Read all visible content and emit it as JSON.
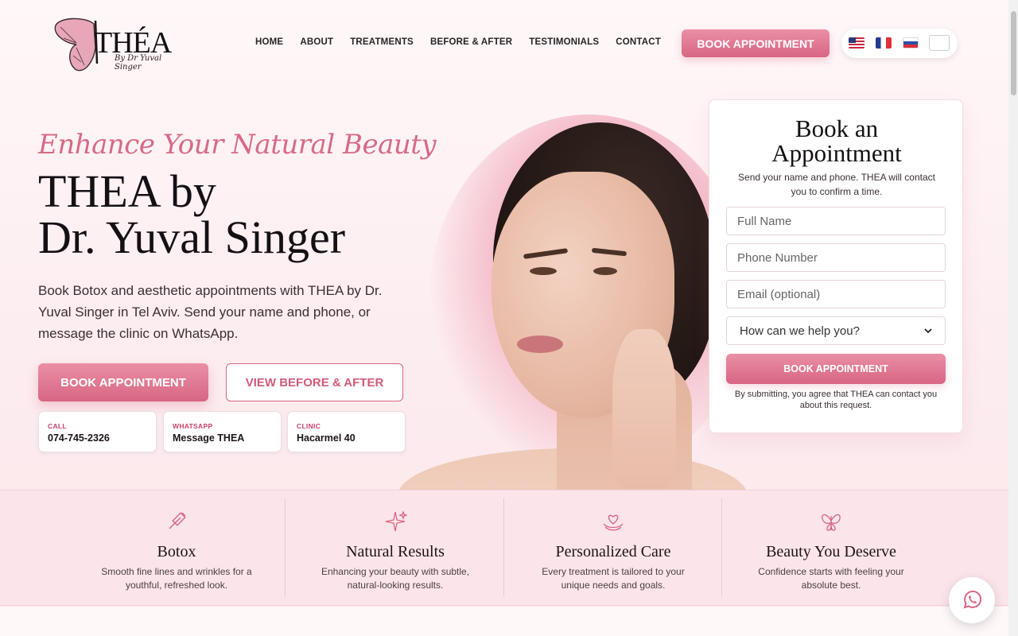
{
  "brand": {
    "logo_text": "THÉA",
    "logo_signature": "By Dr Yuval Singer"
  },
  "nav": {
    "items": [
      "HOME",
      "ABOUT",
      "TREATMENTS",
      "BEFORE & AFTER",
      "TESTIMONIALS",
      "CONTACT"
    ]
  },
  "header": {
    "book_label": "BOOK APPOINTMENT"
  },
  "languages": [
    "us-flag",
    "fr-flag",
    "ru-flag"
  ],
  "hero": {
    "eyebrow": "Enhance Your Natural Beauty",
    "title_line1": "THEA by",
    "title_line2": "Dr. Yuval Singer",
    "description": "Book Botox and aesthetic appointments with THEA by Dr. Yuval Singer in Tel Aviv. Send your name and phone, or message the clinic on WhatsApp.",
    "primary_label": "BOOK APPOINTMENT",
    "secondary_label": "VIEW BEFORE & AFTER",
    "cards": [
      {
        "label": "CALL",
        "value": "074-745-2326"
      },
      {
        "label": "WHATSAPP",
        "value": "Message THEA"
      },
      {
        "label": "CLINIC",
        "value": "Hacarmel 40"
      }
    ]
  },
  "form": {
    "title_line1": "Book an",
    "title_line2": "Appointment",
    "subtitle": "Send your name and phone. THEA will contact you to confirm a time.",
    "name_placeholder": "Full Name",
    "phone_placeholder": "Phone Number",
    "email_placeholder": "Email (optional)",
    "help_selected": "How can we help you?",
    "submit_label": "BOOK APPOINTMENT",
    "note": "By submitting, you agree that THEA can contact you about this request."
  },
  "features": [
    {
      "icon": "syringe-icon",
      "title": "Botox",
      "desc": "Smooth fine lines and wrinkles for a youthful, refreshed look."
    },
    {
      "icon": "sparkles-icon",
      "title": "Natural Results",
      "desc": "Enhancing your beauty with subtle, natural-looking results."
    },
    {
      "icon": "heart-hands-icon",
      "title": "Personalized Care",
      "desc": "Every treatment is tailored to your unique needs and goals."
    },
    {
      "icon": "butterfly-icon",
      "title": "Beauty You Deserve",
      "desc": "Confidence starts with feeling your absolute best."
    }
  ],
  "colors": {
    "accent": "#d86683",
    "accent_light": "#ea8fa5",
    "strip_bg": "#fbe5ea"
  }
}
